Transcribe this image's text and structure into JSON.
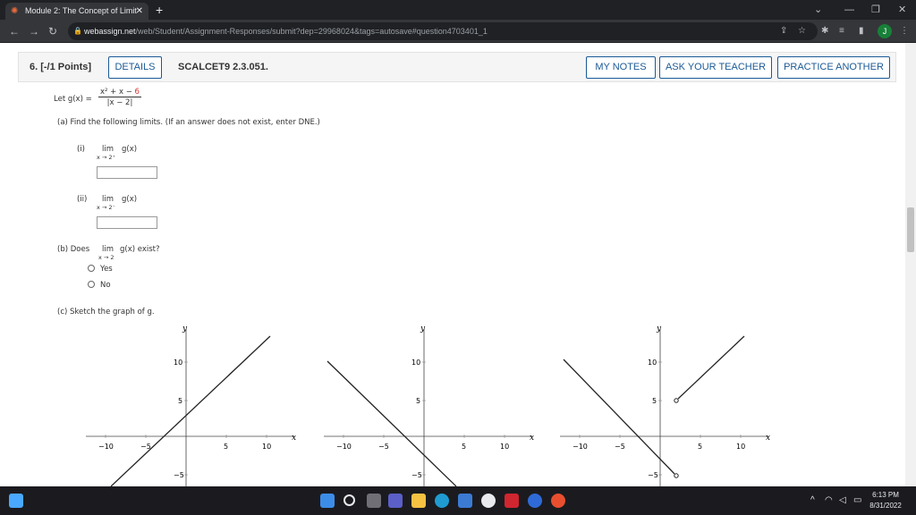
{
  "browser": {
    "tab_title": "Module 2: The Concept of Limit",
    "tab_close": "✕",
    "new_tab": "+",
    "url_host": "webassign.net",
    "url_path": "/web/Student/Assignment-Responses/submit?dep=29968024&tags=autosave#question4703401_1",
    "profile_initial": "J"
  },
  "question": {
    "number": "6. [-/1 Points]",
    "details_label": "DETAILS",
    "ref": "SCALCET9 2.3.051.",
    "my_notes": "MY NOTES",
    "ask_teacher": "ASK YOUR TEACHER",
    "practice_another": "PRACTICE ANOTHER"
  },
  "problem": {
    "let_prefix": "Let g(x) =",
    "numerator_main": "x² + x −",
    "numerator_red": "6",
    "denominator": "|x − 2|",
    "part_a": "(a)  Find the following limits. (If an answer does not exist, enter DNE.)",
    "part_a_i_label": "(i)",
    "part_a_i_lim": "lim",
    "part_a_i_sub": "x → 2⁺",
    "part_a_i_func": "g(x)",
    "part_a_ii_label": "(ii)",
    "part_a_ii_lim": "lim",
    "part_a_ii_sub": "x → 2⁻",
    "part_a_ii_func": "g(x)",
    "part_b_prefix": "(b)  Does",
    "part_b_lim": "lim",
    "part_b_sub": "x → 2",
    "part_b_suffix": "g(x) exist?",
    "option_yes": "Yes",
    "option_no": "No",
    "part_c": "(c)  Sketch the graph of g."
  },
  "graphs": {
    "y_label": "y",
    "x_label": "x",
    "x_ticks": [
      "−10",
      "−5",
      "5",
      "10"
    ],
    "y_ticks": [
      "10",
      "5",
      "−5"
    ]
  },
  "taskbar": {
    "time": "6:13 PM",
    "date": "8/31/2022"
  },
  "colors": {
    "accent": "#1b5a96",
    "red": "#d63030"
  }
}
